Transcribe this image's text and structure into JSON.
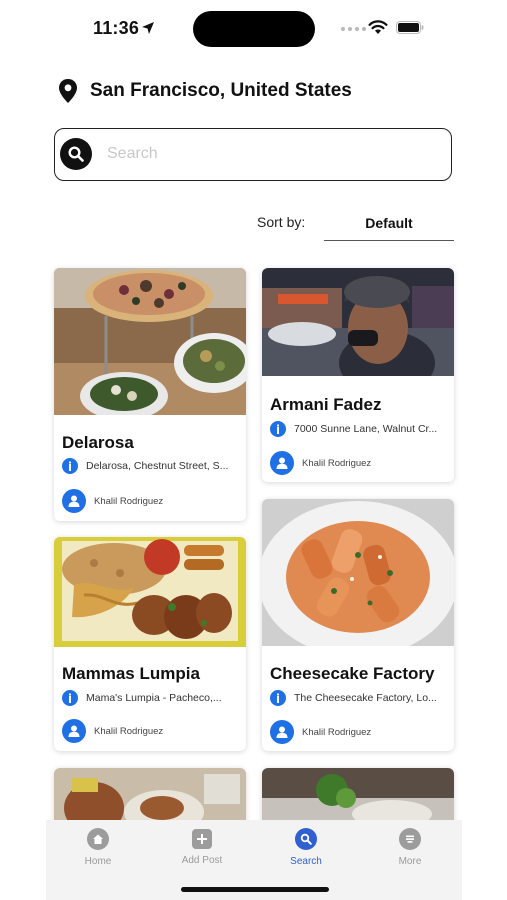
{
  "status": {
    "time": "11:36"
  },
  "location": {
    "text": "San Francisco, United States",
    "icon": "map-pin-icon"
  },
  "search": {
    "placeholder": "Search",
    "value": ""
  },
  "sort": {
    "label": "Sort by:",
    "selected": "Default"
  },
  "cards": [
    {
      "title": "Delarosa",
      "address": "Delarosa, Chestnut Street, S...",
      "user": "Khalil Rodriguez"
    },
    {
      "title": "Armani Fadez",
      "address": "7000 Sunne Lane, Walnut Cr...",
      "user": "Khalil Rodriguez"
    },
    {
      "title": "Mammas Lumpia",
      "address": "Mama's Lumpia - Pacheco,...",
      "user": "Khalil Rodriguez"
    },
    {
      "title": "Cheesecake Factory",
      "address": "The Cheesecake Factory, Lo...",
      "user": "Khalil Rodriguez"
    }
  ],
  "tabs": [
    {
      "label": "Home",
      "icon": "home-icon"
    },
    {
      "label": "Add Post",
      "icon": "plus-icon"
    },
    {
      "label": "Search",
      "icon": "search-icon",
      "active": true
    },
    {
      "label": "More",
      "icon": "menu-icon"
    }
  ],
  "colors": {
    "accent": "#1f6fe5",
    "active_tab": "#2f5fd0",
    "inactive_tab": "#9c9c9c"
  }
}
